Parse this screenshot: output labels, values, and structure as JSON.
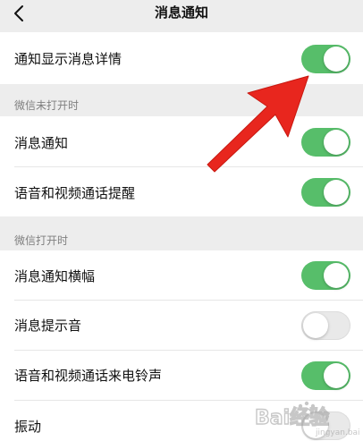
{
  "nav": {
    "title": "消息通知"
  },
  "rows": {
    "show_details": {
      "label": "通知显示消息详情",
      "on": true
    },
    "msg_notify": {
      "label": "消息通知",
      "on": true
    },
    "voice_video_remind": {
      "label": "语音和视频通话提醒",
      "on": true
    },
    "banner": {
      "label": "消息通知横幅",
      "on": true
    },
    "tone": {
      "label": "消息提示音",
      "on": false
    },
    "ringtone": {
      "label": "语音和视频通话来电铃声",
      "on": true
    },
    "vibrate": {
      "label": "振动",
      "on": false
    }
  },
  "sections": {
    "closed": {
      "label": "微信未打开时"
    },
    "open": {
      "label": "微信打开时"
    }
  },
  "colors": {
    "toggle_on": "#57be6a",
    "toggle_off": "#e9e9e9",
    "arrow": "#e8261e",
    "background": "#ededed"
  },
  "watermark": {
    "text": "Bai经验"
  }
}
